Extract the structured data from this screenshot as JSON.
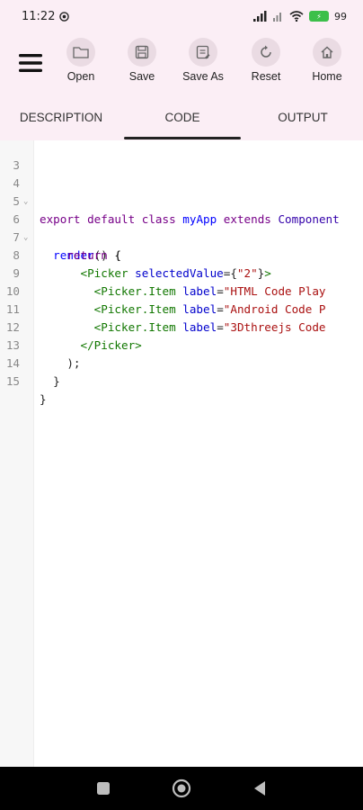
{
  "status": {
    "time": "11:22",
    "battery": "99"
  },
  "toolbar": {
    "open_label": "Open",
    "save_label": "Save",
    "save_as_label": "Save As",
    "reset_label": "Reset",
    "home_label": "Home"
  },
  "tabs": [
    {
      "label": "DESCRIPTION"
    },
    {
      "label": "CODE"
    },
    {
      "label": "OUTPUT"
    }
  ],
  "editor": {
    "lines": [
      {
        "num": "3",
        "code": ""
      },
      {
        "num": "4",
        "code": "export default class myApp extends Component"
      },
      {
        "num": "5",
        "code": ""
      },
      {
        "num": "6",
        "code": "  render() {"
      },
      {
        "num": "7",
        "code": "    return ("
      },
      {
        "num": "8",
        "code": "      <Picker selectedValue={\"2\"}>"
      },
      {
        "num": "9",
        "code": "        <Picker.Item label=\"HTML Code Play"
      },
      {
        "num": "10",
        "code": "        <Picker.Item label=\"Android Code P"
      },
      {
        "num": "11",
        "code": "        <Picker.Item label=\"3Dthreejs Code"
      },
      {
        "num": "12",
        "code": "      </Picker>"
      },
      {
        "num": "13",
        "code": "    );"
      },
      {
        "num": "14",
        "code": "  }"
      },
      {
        "num": "15",
        "code": "}"
      }
    ]
  }
}
